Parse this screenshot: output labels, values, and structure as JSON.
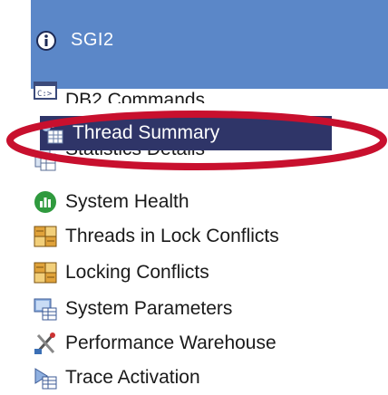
{
  "header": {
    "title": "SGI2",
    "icon": "info-icon",
    "color": "#5b87c8"
  },
  "nav": {
    "items": [
      {
        "label": "DB2 Commands",
        "icon": "command-prompt-icon"
      },
      {
        "label": "Thread Summary",
        "icon": "thread-grid-icon",
        "selected": true
      },
      {
        "label": "Statistics Details",
        "icon": "statistics-sheet-icon"
      },
      {
        "label": "System Health",
        "icon": "health-gauge-icon"
      },
      {
        "label": "Threads in Lock Conflicts",
        "icon": "lock-conflict-icon"
      },
      {
        "label": "Locking Conflicts",
        "icon": "lock-conflict-icon"
      },
      {
        "label": "System Parameters",
        "icon": "system-parameters-icon"
      },
      {
        "label": "Performance Warehouse",
        "icon": "warehouse-tools-icon"
      },
      {
        "label": "Trace Activation",
        "icon": "trace-activation-icon"
      }
    ],
    "selected_color": "#2f3568"
  },
  "annotation": {
    "color": "#c8102e",
    "shape": "ellipse"
  }
}
